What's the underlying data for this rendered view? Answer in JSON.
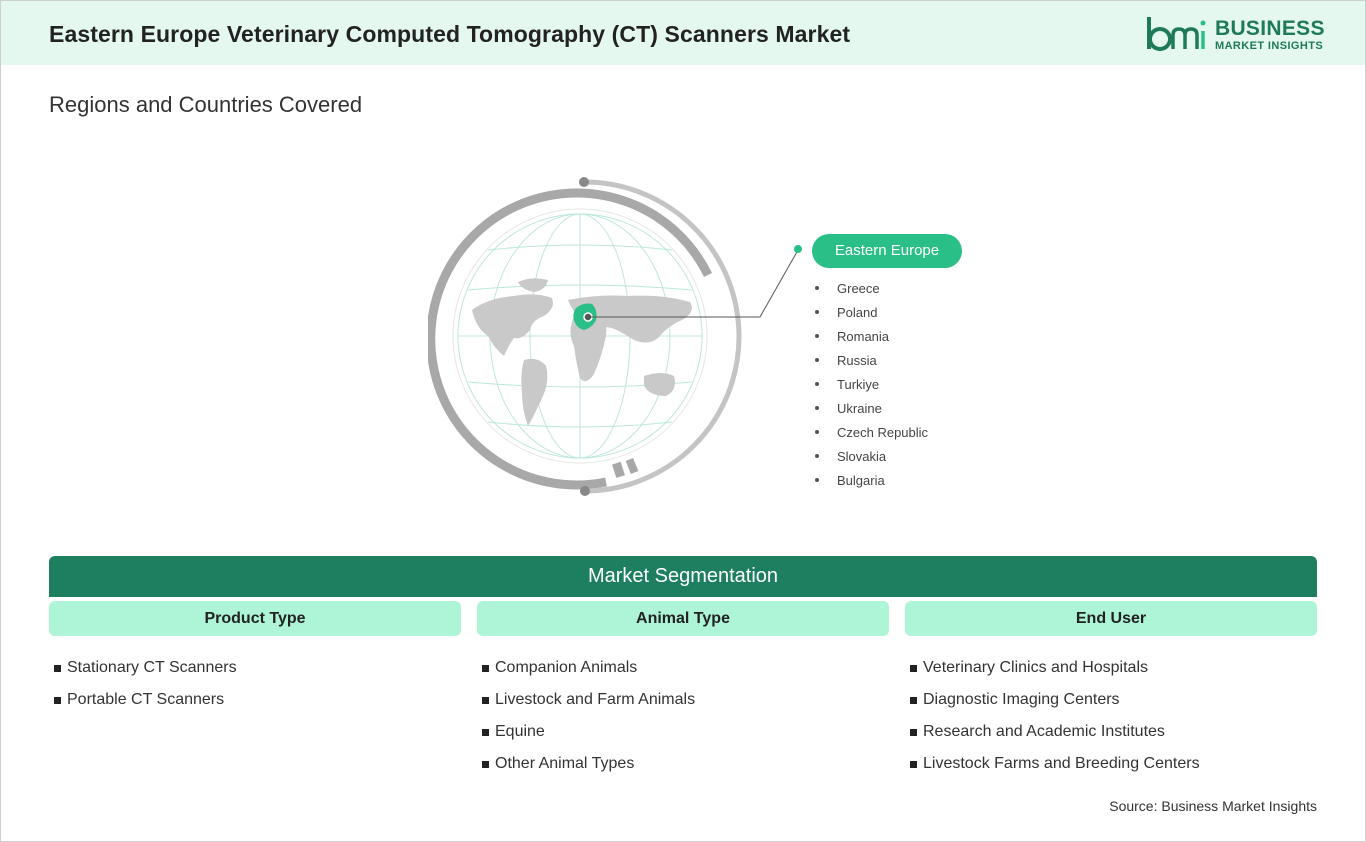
{
  "header": {
    "title": "Eastern Europe Veterinary Computed Tomography (CT) Scanners Market",
    "logo": {
      "line1": "BUSINESS",
      "line2": "MARKET INSIGHTS",
      "icon": "bmi-logo"
    }
  },
  "section_title": "Regions and Countries Covered",
  "map": {
    "region": "Eastern Europe",
    "countries": [
      "Greece",
      "Poland",
      "Romania",
      "Russia",
      "Turkiye",
      "Ukraine",
      "Czech Republic",
      "Slovakia",
      "Bulgaria"
    ]
  },
  "segmentation": {
    "title": "Market Segmentation",
    "columns": [
      {
        "heading": "Product Type",
        "items": [
          "Stationary CT Scanners",
          "Portable CT Scanners"
        ]
      },
      {
        "heading": "Animal Type",
        "items": [
          "Companion Animals",
          "Livestock and Farm Animals",
          "Equine",
          "Other Animal Types"
        ]
      },
      {
        "heading": "End User",
        "items": [
          "Veterinary Clinics and Hospitals",
          "Diagnostic Imaging Centers",
          "Research and Academic Institutes",
          "Livestock Farms and Breeding Centers"
        ]
      }
    ]
  },
  "source": "Source: Business Market Insights",
  "colors": {
    "accent": "#2bbf88",
    "dark_green": "#1d7f5f",
    "light_green": "#aef5d8",
    "header_bg": "#e4f8f0"
  }
}
